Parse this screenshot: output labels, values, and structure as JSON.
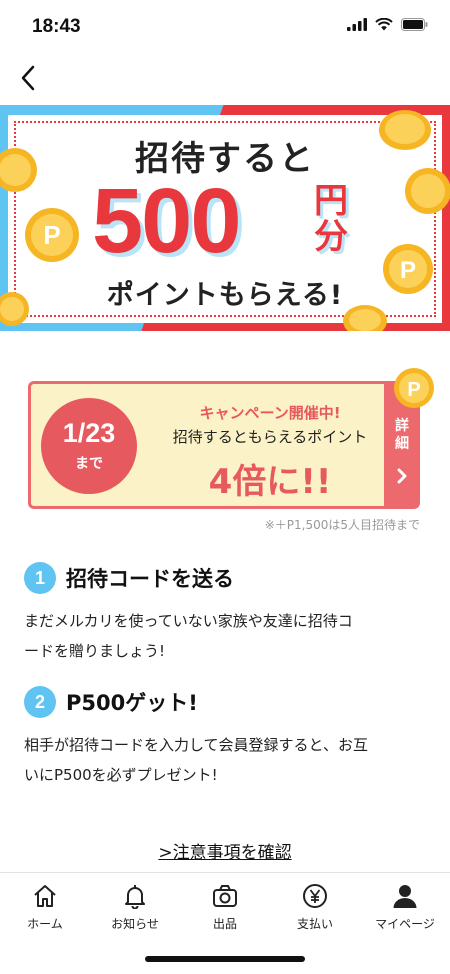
{
  "status_bar": {
    "time": "18:43"
  },
  "hero": {
    "line1": "招待すると",
    "amount": "500",
    "unit_top": "円",
    "unit_bottom": "分",
    "line3": "ポイントもらえる!"
  },
  "campaign": {
    "date": "1/23",
    "until": "まで",
    "headline": "キャンペーン開催中!",
    "sub": "招待するともらえるポイント",
    "multiplier": "4倍に!!",
    "detail_label": "詳細",
    "note": "※＋P1,500は5人目招待まで"
  },
  "steps": [
    {
      "num": "1",
      "title": "招待コードを送る",
      "body_line1": "まだメルカリを使っていない家族や友達に招待コ",
      "body_line2": "ードを贈りましょう!"
    },
    {
      "num": "2",
      "title": "P500ゲット!",
      "body_line1": "相手が招待コードを入力して会員登録すると、お互",
      "body_line2": "いにP500を必ずプレゼント!"
    }
  ],
  "confirm_link": ">注意事項を確認",
  "tabbar": {
    "items": [
      {
        "label": "ホーム",
        "icon": "home-icon"
      },
      {
        "label": "お知らせ",
        "icon": "bell-icon"
      },
      {
        "label": "出品",
        "icon": "camera-icon"
      },
      {
        "label": "支払い",
        "icon": "yen-icon"
      },
      {
        "label": "マイページ",
        "icon": "person-icon"
      }
    ]
  },
  "colors": {
    "red": "#e8383d",
    "blue": "#5fc4f2",
    "cream": "#fbf2c7",
    "coin": "#f6b623"
  }
}
